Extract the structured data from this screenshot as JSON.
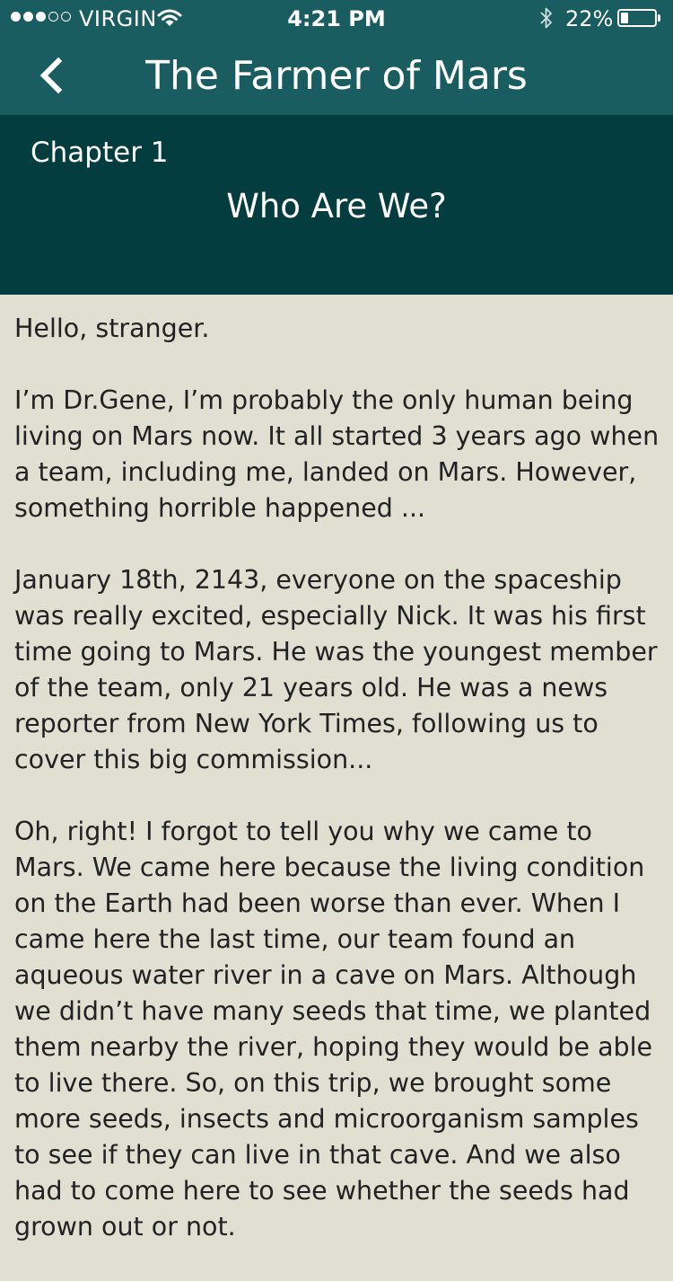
{
  "status_bar": {
    "carrier": "VIRGIN",
    "time": "4:21 PM",
    "battery_percent": "22%",
    "battery_level": 0.22,
    "signal_strength": 3,
    "signal_max": 5
  },
  "nav": {
    "title": "The Farmer of Mars"
  },
  "chapter": {
    "label": "Chapter 1",
    "title": "Who Are We?"
  },
  "story": {
    "paragraphs": [
      "Hello, stranger.",
      "I’m Dr.Gene, I’m probably the only human being living on Mars now. It all started 3 years ago when a team, including me, landed on Mars. However, something horrible happened ...",
      "January 18th, 2143, everyone on the spaceship was really excited, especially Nick. It was his first time going to Mars. He was the youngest member of the team, only 21 years old. He was a news reporter from New York Times, following us to cover this big commission...",
      "Oh, right! I forgot to tell you why we came to Mars. We came here because the living condition on the Earth had been worse than ever. When I came here the last time, our team found an aqueous water river in a cave on Mars. Although we didn’t have many seeds that time, we planted them nearby the river, hoping they would be able to live there. So, on this trip, we brought some more seeds, insects and microorganism samples to see if they can live in that cave. And we also had to come here to see whether the seeds had grown out or not."
    ]
  },
  "colors": {
    "nav_background": "#195d61",
    "chapter_background": "#033d3f",
    "page_background": "#e0dfd2",
    "text": "#222222"
  },
  "icons": {
    "back": "chevron-left-icon",
    "wifi": "wifi-icon",
    "bluetooth": "bluetooth-icon",
    "battery": "battery-icon"
  }
}
